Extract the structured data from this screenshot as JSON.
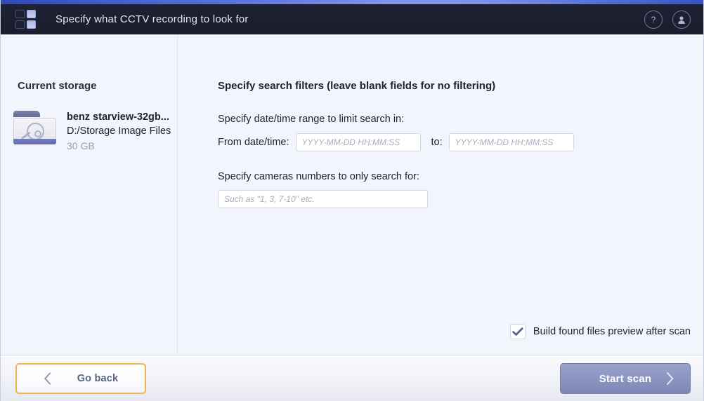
{
  "header": {
    "title": "Specify what CCTV recording to look for",
    "logo_icon": "app-grid-logo",
    "help_icon": "question-mark-icon",
    "account_icon": "user-avatar-icon"
  },
  "sidebar": {
    "title": "Current storage",
    "storage": {
      "icon": "folder-disk-icon",
      "name": "benz starview-32gb...",
      "path": "D:/Storage Image Files",
      "size": "30 GB"
    }
  },
  "main": {
    "section_title": "Specify search filters (leave blank fields for no filtering)",
    "datetime_group": {
      "label": "Specify date/time range to limit search in:",
      "from_label": "From date/time:",
      "from_value": "",
      "from_placeholder": "YYYY-MM-DD HH:MM:SS",
      "to_label": "to:",
      "to_value": "",
      "to_placeholder": "YYYY-MM-DD HH:MM:SS"
    },
    "cameras_group": {
      "label": "Specify cameras numbers to only search for:",
      "value": "",
      "placeholder": "Such as \"1, 3, 7-10\" etc."
    },
    "preview_checkbox": {
      "label": "Build found files preview after scan",
      "checked": true,
      "icon": "checkmark-icon"
    }
  },
  "footer": {
    "back_button": {
      "label": "Go back",
      "icon": "chevron-left-icon"
    },
    "scan_button": {
      "label": "Start scan",
      "icon": "chevron-right-icon"
    }
  },
  "colors": {
    "accent_bar": "#5d74dd",
    "header_bg": "#1b1f2f",
    "page_bg": "#f2f5fc",
    "focus_ring": "#eab354",
    "primary_button": "#8e97c2",
    "check_mark": "#5a6490"
  }
}
